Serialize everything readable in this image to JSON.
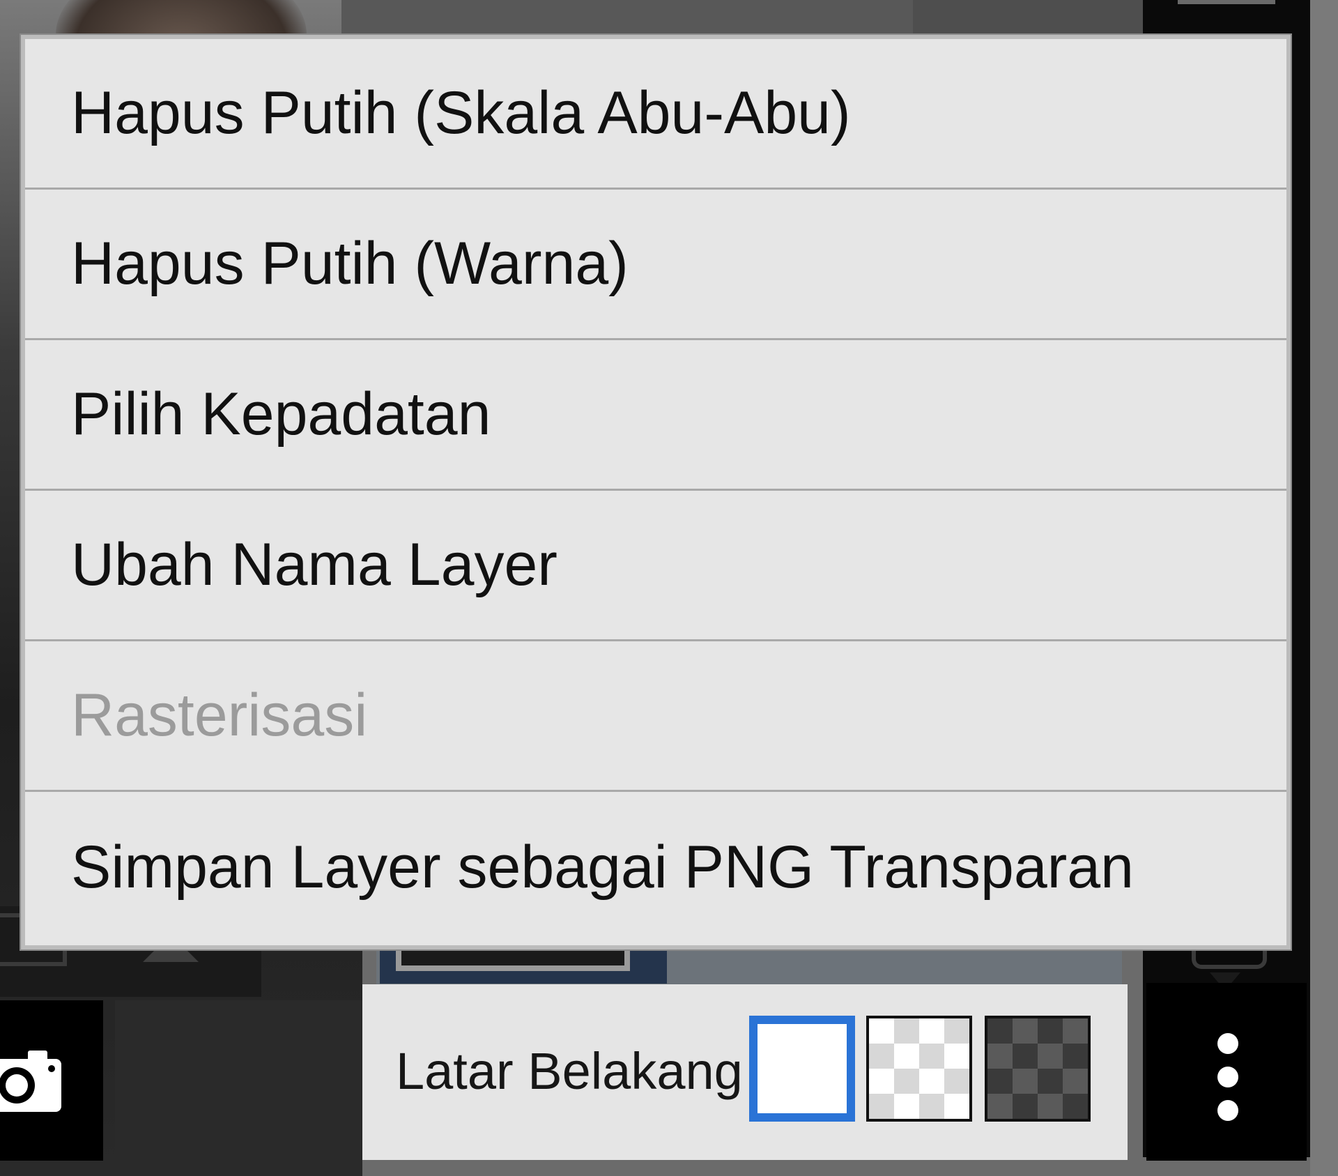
{
  "menu": {
    "items": [
      {
        "label": "Hapus Putih (Skala Abu-Abu)",
        "enabled": true
      },
      {
        "label": "Hapus Putih (Warna)",
        "enabled": true
      },
      {
        "label": "Pilih Kepadatan",
        "enabled": true
      },
      {
        "label": "Ubah Nama Layer",
        "enabled": true
      },
      {
        "label": "Rasterisasi",
        "enabled": false
      },
      {
        "label": "Simpan Layer sebagai PNG Transparan",
        "enabled": true
      }
    ]
  },
  "background_selector": {
    "label": "Latar Belakang",
    "options": [
      {
        "name": "white",
        "selected": true
      },
      {
        "name": "light-checker",
        "selected": false
      },
      {
        "name": "dark-checker",
        "selected": false
      }
    ],
    "selected_color": "#2a73d6"
  },
  "icons": {
    "more": "more-vertical-icon",
    "camera": "camera-icon"
  }
}
